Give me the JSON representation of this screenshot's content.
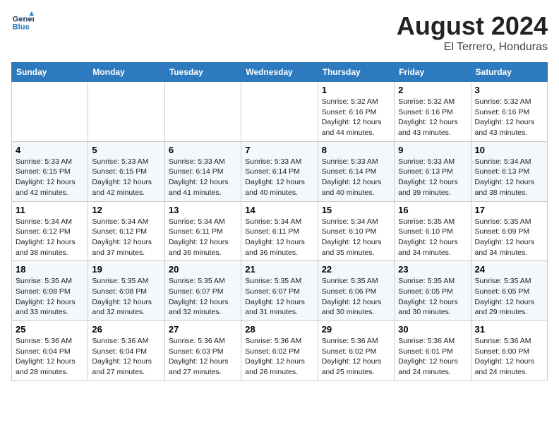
{
  "header": {
    "logo_line1": "General",
    "logo_line2": "Blue",
    "month_year": "August 2024",
    "location": "El Terrero, Honduras"
  },
  "weekdays": [
    "Sunday",
    "Monday",
    "Tuesday",
    "Wednesday",
    "Thursday",
    "Friday",
    "Saturday"
  ],
  "weeks": [
    [
      {
        "day": "",
        "info": ""
      },
      {
        "day": "",
        "info": ""
      },
      {
        "day": "",
        "info": ""
      },
      {
        "day": "",
        "info": ""
      },
      {
        "day": "1",
        "info": "Sunrise: 5:32 AM\nSunset: 6:16 PM\nDaylight: 12 hours\nand 44 minutes."
      },
      {
        "day": "2",
        "info": "Sunrise: 5:32 AM\nSunset: 6:16 PM\nDaylight: 12 hours\nand 43 minutes."
      },
      {
        "day": "3",
        "info": "Sunrise: 5:32 AM\nSunset: 6:16 PM\nDaylight: 12 hours\nand 43 minutes."
      }
    ],
    [
      {
        "day": "4",
        "info": "Sunrise: 5:33 AM\nSunset: 6:15 PM\nDaylight: 12 hours\nand 42 minutes."
      },
      {
        "day": "5",
        "info": "Sunrise: 5:33 AM\nSunset: 6:15 PM\nDaylight: 12 hours\nand 42 minutes."
      },
      {
        "day": "6",
        "info": "Sunrise: 5:33 AM\nSunset: 6:14 PM\nDaylight: 12 hours\nand 41 minutes."
      },
      {
        "day": "7",
        "info": "Sunrise: 5:33 AM\nSunset: 6:14 PM\nDaylight: 12 hours\nand 40 minutes."
      },
      {
        "day": "8",
        "info": "Sunrise: 5:33 AM\nSunset: 6:14 PM\nDaylight: 12 hours\nand 40 minutes."
      },
      {
        "day": "9",
        "info": "Sunrise: 5:33 AM\nSunset: 6:13 PM\nDaylight: 12 hours\nand 39 minutes."
      },
      {
        "day": "10",
        "info": "Sunrise: 5:34 AM\nSunset: 6:13 PM\nDaylight: 12 hours\nand 38 minutes."
      }
    ],
    [
      {
        "day": "11",
        "info": "Sunrise: 5:34 AM\nSunset: 6:12 PM\nDaylight: 12 hours\nand 38 minutes."
      },
      {
        "day": "12",
        "info": "Sunrise: 5:34 AM\nSunset: 6:12 PM\nDaylight: 12 hours\nand 37 minutes."
      },
      {
        "day": "13",
        "info": "Sunrise: 5:34 AM\nSunset: 6:11 PM\nDaylight: 12 hours\nand 36 minutes."
      },
      {
        "day": "14",
        "info": "Sunrise: 5:34 AM\nSunset: 6:11 PM\nDaylight: 12 hours\nand 36 minutes."
      },
      {
        "day": "15",
        "info": "Sunrise: 5:34 AM\nSunset: 6:10 PM\nDaylight: 12 hours\nand 35 minutes."
      },
      {
        "day": "16",
        "info": "Sunrise: 5:35 AM\nSunset: 6:10 PM\nDaylight: 12 hours\nand 34 minutes."
      },
      {
        "day": "17",
        "info": "Sunrise: 5:35 AM\nSunset: 6:09 PM\nDaylight: 12 hours\nand 34 minutes."
      }
    ],
    [
      {
        "day": "18",
        "info": "Sunrise: 5:35 AM\nSunset: 6:08 PM\nDaylight: 12 hours\nand 33 minutes."
      },
      {
        "day": "19",
        "info": "Sunrise: 5:35 AM\nSunset: 6:08 PM\nDaylight: 12 hours\nand 32 minutes."
      },
      {
        "day": "20",
        "info": "Sunrise: 5:35 AM\nSunset: 6:07 PM\nDaylight: 12 hours\nand 32 minutes."
      },
      {
        "day": "21",
        "info": "Sunrise: 5:35 AM\nSunset: 6:07 PM\nDaylight: 12 hours\nand 31 minutes."
      },
      {
        "day": "22",
        "info": "Sunrise: 5:35 AM\nSunset: 6:06 PM\nDaylight: 12 hours\nand 30 minutes."
      },
      {
        "day": "23",
        "info": "Sunrise: 5:35 AM\nSunset: 6:05 PM\nDaylight: 12 hours\nand 30 minutes."
      },
      {
        "day": "24",
        "info": "Sunrise: 5:35 AM\nSunset: 6:05 PM\nDaylight: 12 hours\nand 29 minutes."
      }
    ],
    [
      {
        "day": "25",
        "info": "Sunrise: 5:36 AM\nSunset: 6:04 PM\nDaylight: 12 hours\nand 28 minutes."
      },
      {
        "day": "26",
        "info": "Sunrise: 5:36 AM\nSunset: 6:04 PM\nDaylight: 12 hours\nand 27 minutes."
      },
      {
        "day": "27",
        "info": "Sunrise: 5:36 AM\nSunset: 6:03 PM\nDaylight: 12 hours\nand 27 minutes."
      },
      {
        "day": "28",
        "info": "Sunrise: 5:36 AM\nSunset: 6:02 PM\nDaylight: 12 hours\nand 26 minutes."
      },
      {
        "day": "29",
        "info": "Sunrise: 5:36 AM\nSunset: 6:02 PM\nDaylight: 12 hours\nand 25 minutes."
      },
      {
        "day": "30",
        "info": "Sunrise: 5:36 AM\nSunset: 6:01 PM\nDaylight: 12 hours\nand 24 minutes."
      },
      {
        "day": "31",
        "info": "Sunrise: 5:36 AM\nSunset: 6:00 PM\nDaylight: 12 hours\nand 24 minutes."
      }
    ]
  ]
}
